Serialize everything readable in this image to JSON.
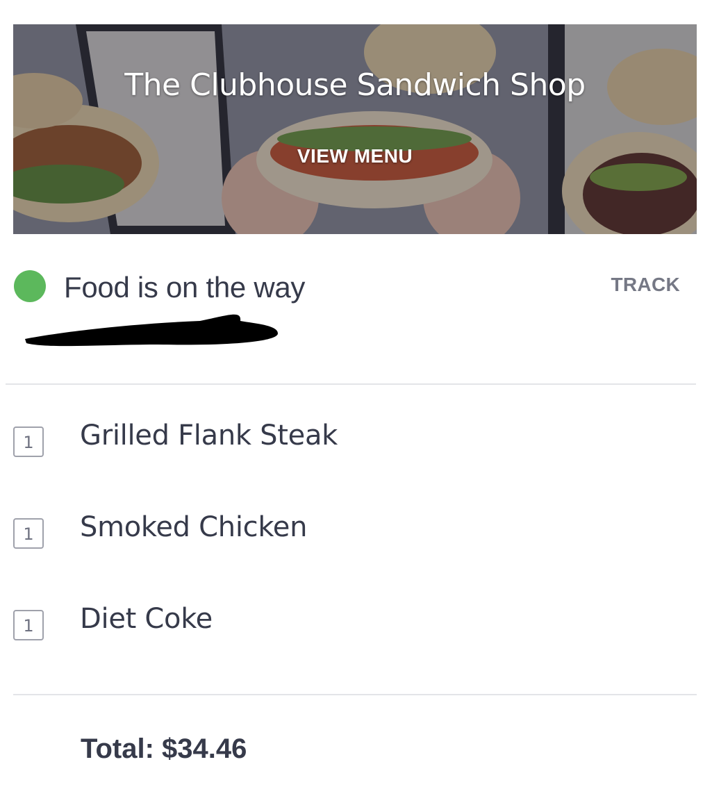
{
  "hero": {
    "title": "The Clubhouse Sandwich Shop",
    "menu_label": "VIEW MENU",
    "image_subject": "sandwiches-photo"
  },
  "status": {
    "text": "Food is on the way",
    "track_label": "TRACK",
    "indicator_color": "#5cb85c"
  },
  "items": [
    {
      "quantity": "1",
      "name": "Grilled Flank Steak"
    },
    {
      "quantity": "1",
      "name": "Smoked Chicken"
    },
    {
      "quantity": "1",
      "name": "Diet Coke"
    }
  ],
  "total": "Total: $34.46"
}
